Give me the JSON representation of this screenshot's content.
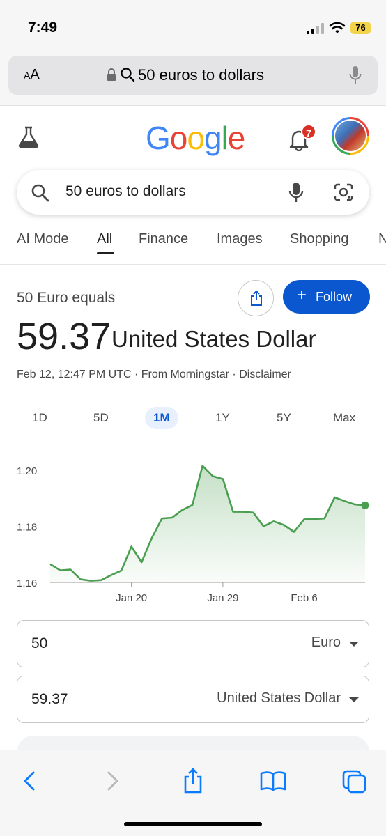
{
  "status_bar": {
    "time": "7:49",
    "battery": "76"
  },
  "address_bar": {
    "text_size_label_small": "A",
    "text_size_label_large": "A",
    "url_text": "50 euros to dollars"
  },
  "header": {
    "logo_letters": [
      "G",
      "o",
      "o",
      "g",
      "l",
      "e"
    ],
    "logo_colors": [
      "#4285f4",
      "#ea4335",
      "#fbbc05",
      "#4285f4",
      "#34a853",
      "#ea4335"
    ],
    "notification_count": "7"
  },
  "search": {
    "query": "50 euros to dollars"
  },
  "tabs": [
    {
      "label": "AI Mode",
      "active": false
    },
    {
      "label": "All",
      "active": true
    },
    {
      "label": "Finance",
      "active": false
    },
    {
      "label": "Images",
      "active": false
    },
    {
      "label": "Shopping",
      "active": false
    },
    {
      "label": "N",
      "active": false
    }
  ],
  "result": {
    "equals_text": "50 Euro equals",
    "follow_label": "Follow",
    "value": "59.37",
    "unit": "United States Dollar",
    "meta": "Feb 12, 12:47 PM UTC · From Morningstar · Disclaimer"
  },
  "ranges": [
    "1D",
    "5D",
    "1M",
    "1Y",
    "5Y",
    "Max"
  ],
  "active_range": "1M",
  "chart_data": {
    "type": "area",
    "ytick_labels": [
      "1.20",
      "1.18",
      "1.16"
    ],
    "yticks": [
      1.2,
      1.18,
      1.16
    ],
    "ylim": [
      1.16,
      1.2
    ],
    "xtick_labels": [
      "Jan 20",
      "Jan 29",
      "Feb 6"
    ],
    "xlim": [
      "Jan 12",
      "Feb 12"
    ],
    "x": [
      "Jan 12",
      "Jan 13",
      "Jan 14",
      "Jan 15",
      "Jan 16",
      "Jan 17",
      "Jan 18",
      "Jan 19",
      "Jan 20",
      "Jan 21",
      "Jan 22",
      "Jan 23",
      "Jan 24",
      "Jan 25",
      "Jan 26",
      "Jan 27",
      "Jan 28",
      "Jan 29",
      "Jan 30",
      "Jan 31",
      "Feb 1",
      "Feb 2",
      "Feb 3",
      "Feb 4",
      "Feb 5",
      "Feb 6",
      "Feb 7",
      "Feb 8",
      "Feb 9",
      "Feb 10",
      "Feb 11",
      "Feb 12"
    ],
    "y": [
      1.1665,
      1.1643,
      1.1646,
      1.1611,
      1.1606,
      1.1608,
      1.1626,
      1.1642,
      1.1728,
      1.1672,
      1.1758,
      1.1828,
      1.1831,
      1.1858,
      1.1876,
      1.2016,
      1.1979,
      1.1969,
      1.1852,
      1.1852,
      1.1849,
      1.18,
      1.1818,
      1.1805,
      1.178,
      1.1825,
      1.1826,
      1.1828,
      1.1903,
      1.189,
      1.1878,
      1.1875
    ],
    "grid": false,
    "line_color": "#4a9e4f"
  },
  "converter": {
    "from_value": "59.37",
    "from_value_top": "50",
    "from_unit": "Euro",
    "to_value": "59.37",
    "to_unit": "United States Dollar"
  }
}
